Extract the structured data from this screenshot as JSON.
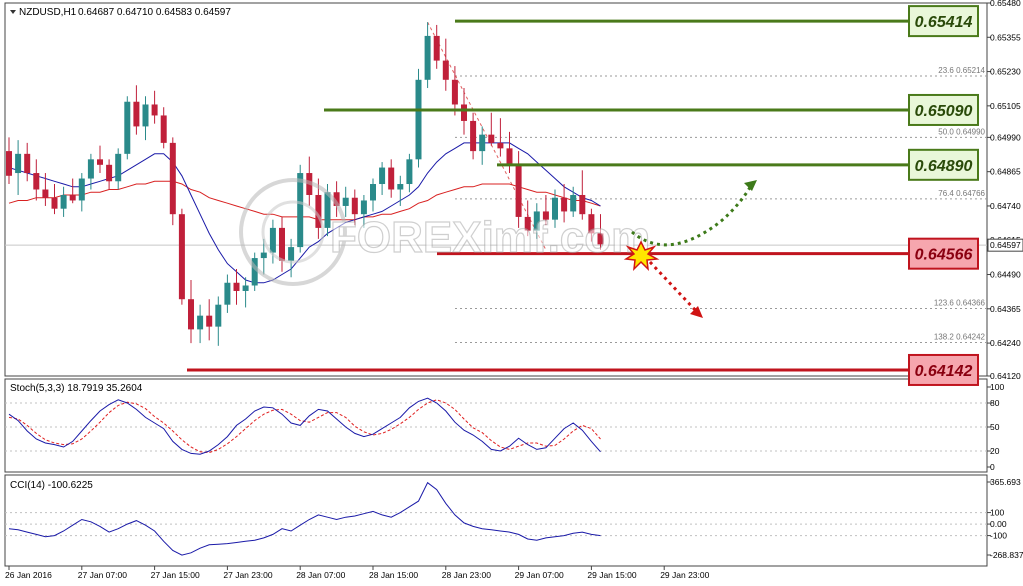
{
  "header": {
    "symbol_timeframe": "NZDUSD,H1",
    "ohlc": "0.64687 0.64710 0.64583 0.64597"
  },
  "watermark": "FOREXimf.com",
  "colors": {
    "bull": "#2a8a8a",
    "bear": "#c0203a",
    "ma_fast": "#1a1aa8",
    "ma_slow": "#d82020",
    "resistance": "#4a7a1a",
    "support": "#c0141e",
    "resistance_box_bg": "#e9f7d9",
    "support_box_bg": "#f6a6ae",
    "arrow_up": "#3d7a1a",
    "arrow_down": "#d01414",
    "stoch_main": "#1a1aa8",
    "stoch_signal": "#e02020",
    "cci": "#1a1aa8"
  },
  "chart_data": [
    {
      "type": "candlestick",
      "panel": "price",
      "ylim": [
        0.6412,
        0.6548
      ],
      "y_ticks": [
        "0.65480",
        "0.65355",
        "0.65230",
        "0.65105",
        "0.64990",
        "0.64865",
        "0.64740",
        "0.64615",
        "0.64490",
        "0.64365",
        "0.64240",
        "0.64120"
      ],
      "current_price": "0.64597",
      "x_ticks": [
        "26 Jan 2016",
        "27 Jan 07:00",
        "27 Jan 15:00",
        "27 Jan 23:00",
        "28 Jan 07:00",
        "28 Jan 15:00",
        "28 Jan 23:00",
        "29 Jan 07:00",
        "29 Jan 15:00",
        "29 Jan 23:00"
      ],
      "x_tick_bars": [
        0,
        8,
        16,
        24,
        32,
        40,
        48,
        56,
        64,
        72
      ],
      "bars_ohlc": [
        [
          0.6494,
          0.6499,
          0.6482,
          0.6485
        ],
        [
          0.6486,
          0.6498,
          0.6478,
          0.6493
        ],
        [
          0.6493,
          0.6497,
          0.6483,
          0.6486
        ],
        [
          0.6486,
          0.6491,
          0.6476,
          0.648
        ],
        [
          0.648,
          0.6486,
          0.6474,
          0.6477
        ],
        [
          0.6477,
          0.6482,
          0.6471,
          0.6473
        ],
        [
          0.6473,
          0.6481,
          0.647,
          0.6478
        ],
        [
          0.6478,
          0.6484,
          0.6475,
          0.6476
        ],
        [
          0.6476,
          0.6486,
          0.6472,
          0.6484
        ],
        [
          0.6484,
          0.6493,
          0.648,
          0.6491
        ],
        [
          0.6491,
          0.6496,
          0.6486,
          0.6489
        ],
        [
          0.6489,
          0.6491,
          0.648,
          0.6483
        ],
        [
          0.6483,
          0.6495,
          0.648,
          0.6493
        ],
        [
          0.6493,
          0.6514,
          0.6491,
          0.6512
        ],
        [
          0.6512,
          0.6518,
          0.65,
          0.6503
        ],
        [
          0.6503,
          0.6514,
          0.6498,
          0.6511
        ],
        [
          0.6511,
          0.6516,
          0.6504,
          0.6507
        ],
        [
          0.6507,
          0.651,
          0.6495,
          0.6497
        ],
        [
          0.6497,
          0.6499,
          0.6467,
          0.6471
        ],
        [
          0.6471,
          0.6473,
          0.6438,
          0.644
        ],
        [
          0.644,
          0.6447,
          0.6424,
          0.6429
        ],
        [
          0.6429,
          0.6438,
          0.6424,
          0.6434
        ],
        [
          0.6434,
          0.644,
          0.6425,
          0.643
        ],
        [
          0.643,
          0.6441,
          0.6423,
          0.6438
        ],
        [
          0.6438,
          0.6449,
          0.6435,
          0.6446
        ],
        [
          0.6446,
          0.6451,
          0.6438,
          0.6443
        ],
        [
          0.6443,
          0.6448,
          0.6437,
          0.6445
        ],
        [
          0.6445,
          0.6457,
          0.6443,
          0.6455
        ],
        [
          0.6455,
          0.6462,
          0.6449,
          0.6457
        ],
        [
          0.6457,
          0.6469,
          0.6453,
          0.6466
        ],
        [
          0.6466,
          0.647,
          0.645,
          0.6454
        ],
        [
          0.6454,
          0.6462,
          0.6448,
          0.6459
        ],
        [
          0.6459,
          0.6489,
          0.6457,
          0.6486
        ],
        [
          0.6486,
          0.6492,
          0.6474,
          0.6478
        ],
        [
          0.6478,
          0.6484,
          0.6462,
          0.6466
        ],
        [
          0.6466,
          0.6482,
          0.6463,
          0.6479
        ],
        [
          0.6479,
          0.6483,
          0.647,
          0.6474
        ],
        [
          0.6474,
          0.6481,
          0.647,
          0.6477
        ],
        [
          0.6477,
          0.648,
          0.6467,
          0.6471
        ],
        [
          0.6471,
          0.6478,
          0.6466,
          0.6476
        ],
        [
          0.6476,
          0.6484,
          0.6472,
          0.6482
        ],
        [
          0.6482,
          0.649,
          0.6478,
          0.6488
        ],
        [
          0.6488,
          0.6491,
          0.6477,
          0.648
        ],
        [
          0.648,
          0.6485,
          0.6474,
          0.6482
        ],
        [
          0.6482,
          0.6493,
          0.6479,
          0.6491
        ],
        [
          0.6491,
          0.6524,
          0.6488,
          0.652
        ],
        [
          0.652,
          0.6541,
          0.6517,
          0.6536
        ],
        [
          0.6536,
          0.654,
          0.6524,
          0.6527
        ],
        [
          0.6527,
          0.6535,
          0.6516,
          0.652
        ],
        [
          0.652,
          0.6525,
          0.6507,
          0.6511
        ],
        [
          0.6511,
          0.6517,
          0.65,
          0.6505
        ],
        [
          0.6505,
          0.6508,
          0.6491,
          0.6494
        ],
        [
          0.6494,
          0.6503,
          0.6489,
          0.65
        ],
        [
          0.65,
          0.6508,
          0.6496,
          0.6497
        ],
        [
          0.6497,
          0.6506,
          0.6492,
          0.6495
        ],
        [
          0.6495,
          0.6501,
          0.6486,
          0.6489
        ],
        [
          0.6489,
          0.6494,
          0.6466,
          0.647
        ],
        [
          0.647,
          0.6476,
          0.6463,
          0.6465
        ],
        [
          0.6465,
          0.6475,
          0.6462,
          0.6472
        ],
        [
          0.6472,
          0.6478,
          0.6467,
          0.6469
        ],
        [
          0.6469,
          0.648,
          0.6466,
          0.6477
        ],
        [
          0.6477,
          0.6482,
          0.6468,
          0.6472
        ],
        [
          0.6472,
          0.6481,
          0.647,
          0.6478
        ],
        [
          0.6478,
          0.6487,
          0.6469,
          0.6471
        ],
        [
          0.6471,
          0.6473,
          0.6461,
          0.6464
        ],
        [
          0.6464,
          0.6471,
          0.6458,
          0.646
        ]
      ],
      "ma_fast": [
        0.6488,
        0.6487,
        0.6486,
        0.6485,
        0.6484,
        0.6483,
        0.6482,
        0.6481,
        0.6481,
        0.6482,
        0.6483,
        0.6484,
        0.6485,
        0.6487,
        0.6489,
        0.6491,
        0.6493,
        0.6493,
        0.649,
        0.6485,
        0.6478,
        0.6471,
        0.6464,
        0.6458,
        0.6453,
        0.645,
        0.6447,
        0.6446,
        0.6446,
        0.6447,
        0.6449,
        0.6451,
        0.6455,
        0.6459,
        0.6461,
        0.6464,
        0.6466,
        0.6468,
        0.6469,
        0.647,
        0.6471,
        0.6472,
        0.6474,
        0.6476,
        0.6478,
        0.6481,
        0.6486,
        0.649,
        0.6493,
        0.6495,
        0.6497,
        0.6497,
        0.6497,
        0.6497,
        0.6497,
        0.6497,
        0.6495,
        0.6493,
        0.649,
        0.6487,
        0.6484,
        0.6481,
        0.6479,
        0.6477,
        0.6476,
        0.6474
      ],
      "ma_slow": [
        0.6475,
        0.6476,
        0.6476,
        0.6477,
        0.6477,
        0.6477,
        0.6478,
        0.6478,
        0.6478,
        0.6479,
        0.6479,
        0.648,
        0.648,
        0.6481,
        0.6482,
        0.6482,
        0.6483,
        0.6483,
        0.6483,
        0.6482,
        0.648,
        0.6479,
        0.6477,
        0.6476,
        0.6475,
        0.6474,
        0.6473,
        0.6472,
        0.6471,
        0.6471,
        0.647,
        0.647,
        0.647,
        0.647,
        0.6469,
        0.6469,
        0.6469,
        0.6469,
        0.6469,
        0.647,
        0.647,
        0.6471,
        0.6471,
        0.6472,
        0.6473,
        0.6475,
        0.6476,
        0.6478,
        0.6479,
        0.648,
        0.6481,
        0.6481,
        0.6482,
        0.6482,
        0.6482,
        0.6482,
        0.6481,
        0.648,
        0.6479,
        0.6479,
        0.6478,
        0.6477,
        0.6476,
        0.6476,
        0.6475,
        0.6474
      ],
      "levels": [
        {
          "label": "0.65414",
          "value": 0.65414,
          "kind": "resistance"
        },
        {
          "label": "0.65090",
          "value": 0.6509,
          "kind": "resistance"
        },
        {
          "label": "0.64890",
          "value": 0.6489,
          "kind": "resistance"
        },
        {
          "label": "0.64566",
          "value": 0.64566,
          "kind": "support"
        },
        {
          "label": "0.64142",
          "value": 0.64142,
          "kind": "support"
        }
      ],
      "fibo_levels": [
        {
          "label": "23.6 0.65214",
          "value": 0.65214
        },
        {
          "label": "50.0 0.64990",
          "value": 0.6499
        },
        {
          "label": "76.4 0.64766",
          "value": 0.64766
        },
        {
          "label": "123.6 0.64366",
          "value": 0.64366
        },
        {
          "label": "138.2 0.64242",
          "value": 0.64242
        }
      ],
      "fibo_anchor": {
        "from": [
          46,
          0.6541
        ],
        "to": [
          59,
          0.6458
        ]
      }
    },
    {
      "type": "line",
      "panel": "stochastic",
      "title": "Stoch(5,3,3) 18.7919 35.2604",
      "ylim": [
        0,
        100
      ],
      "y_ticks": [
        "100",
        "80",
        "50",
        "20",
        "0"
      ],
      "main": [
        66,
        58,
        45,
        35,
        30,
        28,
        25,
        32,
        45,
        58,
        70,
        78,
        84,
        80,
        72,
        62,
        55,
        48,
        32,
        22,
        17,
        16,
        20,
        28,
        38,
        52,
        60,
        70,
        75,
        74,
        66,
        55,
        52,
        64,
        72,
        70,
        60,
        50,
        42,
        38,
        41,
        48,
        55,
        62,
        74,
        82,
        86,
        80,
        70,
        56,
        46,
        40,
        32,
        22,
        20,
        26,
        36,
        28,
        22,
        24,
        36,
        48,
        55,
        46,
        32,
        19
      ],
      "signal": [
        62,
        60,
        52,
        42,
        34,
        30,
        28,
        29,
        35,
        45,
        56,
        68,
        77,
        81,
        79,
        73,
        63,
        55,
        45,
        34,
        25,
        19,
        18,
        22,
        29,
        38,
        48,
        58,
        66,
        71,
        72,
        66,
        58,
        56,
        62,
        68,
        68,
        62,
        51,
        44,
        40,
        42,
        47,
        54,
        62,
        72,
        80,
        84,
        80,
        72,
        60,
        49,
        43,
        33,
        25,
        22,
        26,
        30,
        30,
        26,
        27,
        35,
        45,
        52,
        48,
        35
      ]
    },
    {
      "type": "line",
      "panel": "cci",
      "title": "CCI(14) -100.6225",
      "ylim": [
        -268.837,
        365.693
      ],
      "y_ticks": [
        "365.693",
        "100",
        "0.00",
        "-100",
        "-268.837"
      ],
      "values": [
        -40,
        -50,
        -70,
        -90,
        -110,
        -100,
        -60,
        -10,
        40,
        20,
        -20,
        -70,
        -40,
        0,
        30,
        -10,
        -60,
        -150,
        -230,
        -270,
        -250,
        -210,
        -180,
        -175,
        -170,
        -160,
        -150,
        -140,
        -120,
        -90,
        -40,
        -60,
        -10,
        40,
        80,
        60,
        40,
        60,
        70,
        90,
        110,
        80,
        60,
        100,
        150,
        200,
        360,
        300,
        180,
        80,
        10,
        -20,
        -40,
        -50,
        -60,
        -70,
        -90,
        -130,
        -140,
        -120,
        -110,
        -100,
        -80,
        -70,
        -90,
        -100
      ]
    }
  ]
}
